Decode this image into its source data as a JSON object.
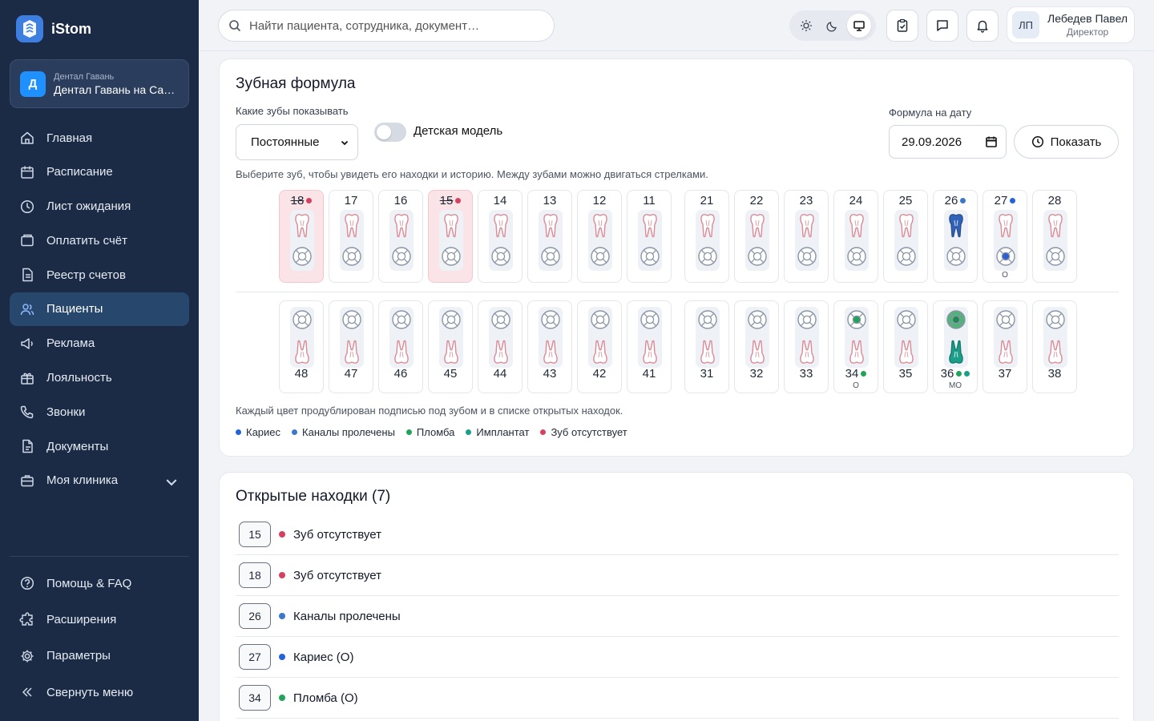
{
  "app": {
    "name": "iStom"
  },
  "clinic": {
    "group": "Дентал Гавань",
    "name": "Дентал Гавань на Са…",
    "initial": "Д"
  },
  "nav": {
    "items": [
      {
        "label": "Главная",
        "icon": "home-icon"
      },
      {
        "label": "Расписание",
        "icon": "calendar-icon"
      },
      {
        "label": "Лист ожидания",
        "icon": "clock-icon"
      },
      {
        "label": "Оплатить счёт",
        "icon": "wallet-icon"
      },
      {
        "label": "Реестр счетов",
        "icon": "document-icon"
      },
      {
        "label": "Пациенты",
        "icon": "users-icon",
        "active": true
      },
      {
        "label": "Реклама",
        "icon": "megaphone-icon"
      },
      {
        "label": "Лояльность",
        "icon": "gift-icon"
      },
      {
        "label": "Звонки",
        "icon": "phone-icon"
      },
      {
        "label": "Документы",
        "icon": "file-icon"
      },
      {
        "label": "Моя клиника",
        "icon": "briefcase-icon"
      }
    ],
    "bottom": [
      {
        "label": "Помощь & FAQ",
        "icon": "help-icon"
      },
      {
        "label": "Расширения",
        "icon": "puzzle-icon"
      },
      {
        "label": "Параметры",
        "icon": "gear-icon"
      },
      {
        "label": "Свернуть меню",
        "icon": "collapse-icon"
      }
    ]
  },
  "search": {
    "placeholder": "Найти пациента, сотрудника, документ…"
  },
  "user": {
    "initials": "ЛП",
    "name": "Лебедев Павел",
    "role": "Директор"
  },
  "formula": {
    "title": "Зубная формула",
    "which_label": "Какие зубы показывать",
    "which_value": "Постоянные",
    "child_model_label": "Детская модель",
    "child_model_on": false,
    "date_label": "Формула на дату",
    "date_value": "29.09.2026",
    "show_button": "Показать",
    "hint": "Выберите зуб, чтобы увидеть его находки и историю. Между зубами можно двигаться стрелками.",
    "note": "Каждый цвет продублирован подписью под зубом и в списке открытых находок.",
    "upper": [
      {
        "n": "18",
        "missing": true,
        "dots": [
          "#d64161"
        ]
      },
      {
        "n": "17"
      },
      {
        "n": "16"
      },
      {
        "n": "15",
        "missing": true,
        "dots": [
          "#d64161"
        ]
      },
      {
        "n": "14"
      },
      {
        "n": "13"
      },
      {
        "n": "12"
      },
      {
        "n": "11"
      },
      {
        "n": "21"
      },
      {
        "n": "22"
      },
      {
        "n": "23"
      },
      {
        "n": "24"
      },
      {
        "n": "25"
      },
      {
        "n": "26",
        "dots": [
          "#3b78c9"
        ],
        "canal": true
      },
      {
        "n": "27",
        "dots": [
          "#2563d8"
        ],
        "sub": "О",
        "caries": true
      },
      {
        "n": "28"
      }
    ],
    "lower": [
      {
        "n": "48"
      },
      {
        "n": "47"
      },
      {
        "n": "46"
      },
      {
        "n": "45"
      },
      {
        "n": "44"
      },
      {
        "n": "43"
      },
      {
        "n": "42"
      },
      {
        "n": "41"
      },
      {
        "n": "31"
      },
      {
        "n": "32"
      },
      {
        "n": "33"
      },
      {
        "n": "34",
        "dots": [
          "#22a35a"
        ],
        "sub": "О",
        "filling": true
      },
      {
        "n": "35"
      },
      {
        "n": "36",
        "dots": [
          "#22a35a",
          "#1b9e8a"
        ],
        "sub": "МО",
        "implant": true
      },
      {
        "n": "37"
      },
      {
        "n": "38"
      }
    ],
    "legend": [
      {
        "label": "Кариес",
        "color": "#2563d8"
      },
      {
        "label": "Каналы пролечены",
        "color": "#3b78c9"
      },
      {
        "label": "Пломба",
        "color": "#22a35a"
      },
      {
        "label": "Имплантат",
        "color": "#1b9e8a"
      },
      {
        "label": "Зуб отсутствует",
        "color": "#d64161"
      }
    ]
  },
  "findings": {
    "title": "Открытые находки (7)",
    "items": [
      {
        "tooth": "15",
        "text": "Зуб отсутствует",
        "color": "#d64161"
      },
      {
        "tooth": "18",
        "text": "Зуб отсутствует",
        "color": "#d64161"
      },
      {
        "tooth": "26",
        "text": "Каналы пролечены",
        "color": "#3b78c9"
      },
      {
        "tooth": "27",
        "text": "Кариес (О)",
        "color": "#2563d8"
      },
      {
        "tooth": "34",
        "text": "Пломба (О)",
        "color": "#22a35a"
      }
    ]
  }
}
